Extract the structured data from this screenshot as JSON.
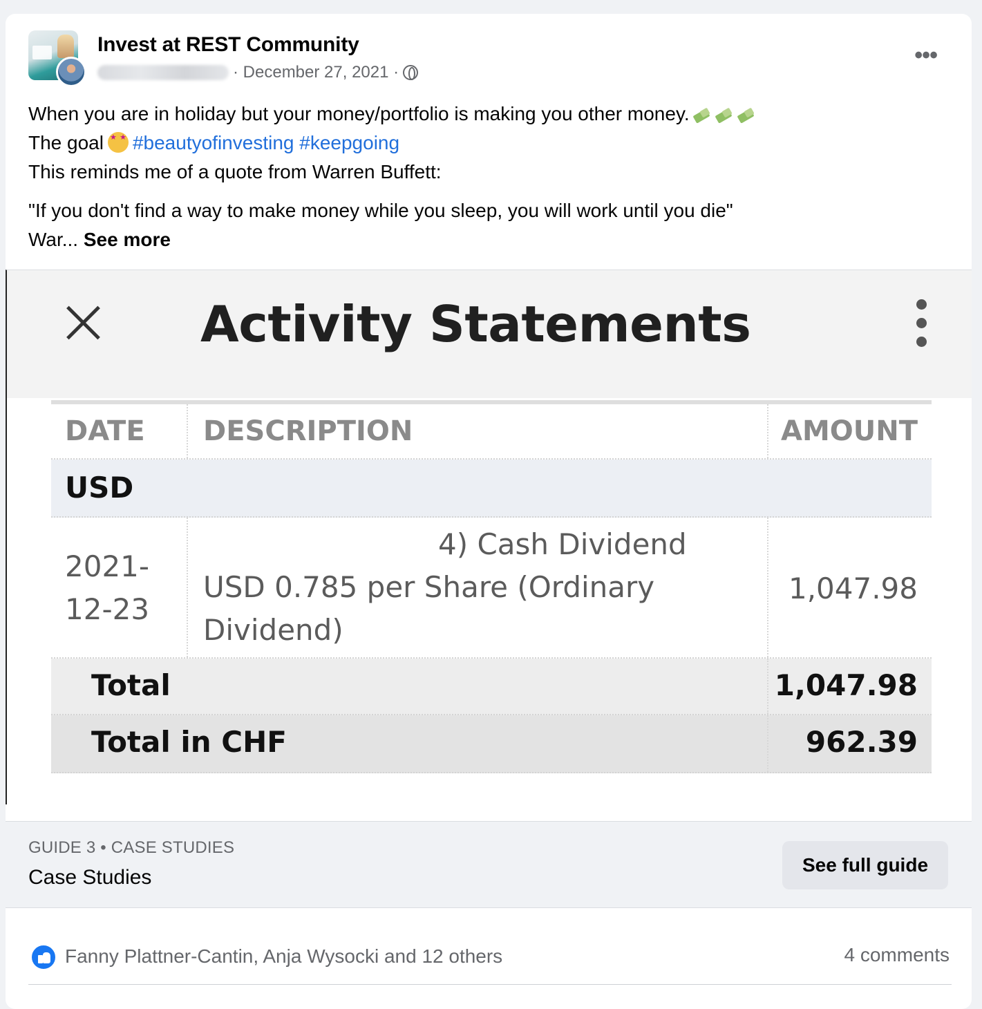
{
  "post": {
    "group_name": "Invest at REST Community",
    "date": "· December 27, 2021 ·",
    "lines": {
      "l1": "When you are in holiday but your money/portfolio is making you other money.",
      "l2_prefix": "The goal",
      "hashtag1": "#beautyofinvesting",
      "hashtag2": "#keepgoing",
      "l3": "This reminds me of a quote from Warren Buffett:",
      "quote": "\"If you don't find a way to make money while you sleep, you will work until you die\"",
      "truncated": "War...",
      "see_more": "See more"
    },
    "icons": {
      "privacy": "globe-icon",
      "menu": "more-icon"
    }
  },
  "statement": {
    "title": "Activity Statements",
    "headers": {
      "date": "DATE",
      "description": "DESCRIPTION",
      "amount": "AMOUNT"
    },
    "currency": "USD",
    "row": {
      "date_l1": "2021-",
      "date_l2": "12-23",
      "desc_l1_visible": "4) Cash Dividend",
      "desc_l2": "USD 0.785 per Share (Ordinary",
      "desc_l3": "Dividend)",
      "amount": "1,047.98"
    },
    "total_label": "Total",
    "total_value": "1,047.98",
    "total_chf_label": "Total in CHF",
    "total_chf_value": "962.39"
  },
  "guide": {
    "kicker": "GUIDE 3 • CASE STUDIES",
    "title": "Case Studies",
    "button": "See full guide"
  },
  "reactions": {
    "names": "Fanny Plattner-Cantin, Anja Wysocki and 12 others",
    "comments": "4 comments"
  },
  "colors": {
    "accent_link": "#216fdb",
    "like_blue": "#1877f2",
    "muted_text": "#65676b"
  }
}
